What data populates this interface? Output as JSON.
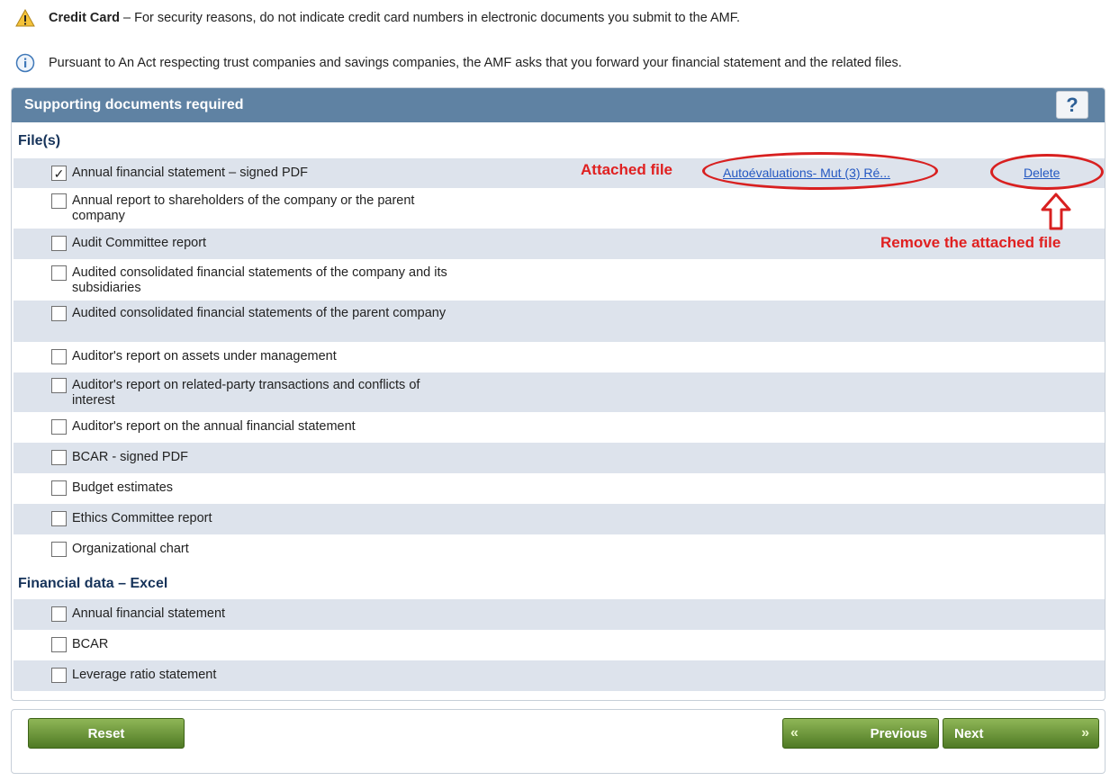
{
  "notices": {
    "credit_bold": "Credit Card",
    "credit_rest": " – For security reasons, do not indicate credit card numbers in electronic documents you submit to the AMF.",
    "info": "Pursuant to An Act respecting trust companies and savings companies, the AMF asks that you forward your financial statement and the related files."
  },
  "panel": {
    "title": "Supporting documents required",
    "help_label": "?"
  },
  "files": {
    "title": "File(s)",
    "items": [
      {
        "label": "Annual financial statement – signed PDF",
        "checked": true
      },
      {
        "label": "Annual report to shareholders of the company or the parent company",
        "checked": false
      },
      {
        "label": "Audit Committee report",
        "checked": false
      },
      {
        "label": "Audited consolidated financial statements of the company and its subsidiaries",
        "checked": false
      },
      {
        "label": "Audited consolidated financial statements of the parent company",
        "checked": false
      },
      {
        "label": "Auditor's report on assets under management",
        "checked": false
      },
      {
        "label": "Auditor's report on related-party transactions and conflicts of interest",
        "checked": false
      },
      {
        "label": "Auditor's report on the annual financial statement",
        "checked": false
      },
      {
        "label": "BCAR - signed PDF",
        "checked": false
      },
      {
        "label": "Budget estimates",
        "checked": false
      },
      {
        "label": "Ethics Committee report",
        "checked": false
      },
      {
        "label": "Organizational chart",
        "checked": false
      }
    ]
  },
  "attachment": {
    "file_link": "Autoévaluations- Mut (3) Ré...",
    "delete_label": "Delete"
  },
  "annotations": {
    "attached_file": "Attached file",
    "remove_attached": "Remove the attached file"
  },
  "financial": {
    "title": "Financial data – Excel",
    "items": [
      {
        "label": "Annual financial statement",
        "checked": false
      },
      {
        "label": "BCAR",
        "checked": false
      },
      {
        "label": "Leverage ratio statement",
        "checked": false
      }
    ]
  },
  "footer": {
    "reset_label": "Reset",
    "previous_label": "Previous",
    "next_label": "Next",
    "previous_arrows": "«",
    "next_arrows": "»"
  },
  "colors": {
    "header_bg": "#5f82a3",
    "alt_row_bg": "#dde3ec",
    "link": "#2458c2",
    "annotation": "#e02020",
    "button_green": "#5e8a2c"
  }
}
